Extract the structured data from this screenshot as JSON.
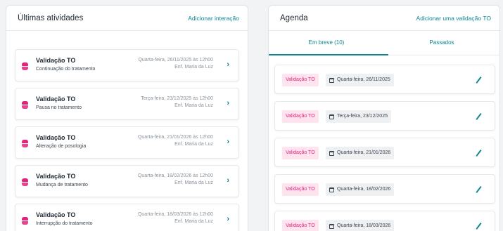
{
  "activities": {
    "title": "Últimas atividades",
    "add_link": "Adicionar interação",
    "items": [
      {
        "title": "Validação TO",
        "subtitle": "Continuação do tratamento",
        "date": "Quarta-feira, 26/11/2025 às 12h00",
        "author": "Enf. Maria da Luz"
      },
      {
        "title": "Validação TO",
        "subtitle": "Pausa no tratamento",
        "date": "Terça-feira, 23/12/2025 às 12h00",
        "author": "Enf. Maria da Luz"
      },
      {
        "title": "Validação TO",
        "subtitle": "Alteração de posologia",
        "date": "Quarta-feira, 21/01/2026 às 12h00",
        "author": "Enf. Maria da Luz"
      },
      {
        "title": "Validação TO",
        "subtitle": "Mudança de tratamento",
        "date": "Quarta-feira, 18/02/2026 às 12h00",
        "author": "Enf. Maria da Luz"
      },
      {
        "title": "Validação TO",
        "subtitle": "Interrupção do tratamento",
        "date": "Quarta-feira, 18/03/2026 às 12h00",
        "author": "Enf. Maria da Luz"
      }
    ]
  },
  "agenda": {
    "title": "Agenda",
    "add_link": "Adicionar uma validação TO",
    "tabs": [
      {
        "label": "Em breve (10)",
        "active": true
      },
      {
        "label": "Passados",
        "active": false
      }
    ],
    "items": [
      {
        "badge": "Validação TO",
        "date": "Quarta-feira, 26/11/2025"
      },
      {
        "badge": "Validação TO",
        "date": "Terça-feira, 23/12/2025"
      },
      {
        "badge": "Validação TO",
        "date": "Quarta-feira, 21/01/2026"
      },
      {
        "badge": "Validação TO",
        "date": "Quarta-feira, 18/02/2026"
      },
      {
        "badge": "Validação TO",
        "date": "Quarta-feira, 18/03/2026"
      }
    ]
  },
  "icons": {
    "activity": "pill-icon",
    "chevron": "chevron-right-icon",
    "calendar": "calendar-icon",
    "edit": "pencil-icon"
  },
  "colors": {
    "accent": "#0a8591",
    "badge_text": "#e3227a",
    "badge_bg": "#fde4ef"
  }
}
